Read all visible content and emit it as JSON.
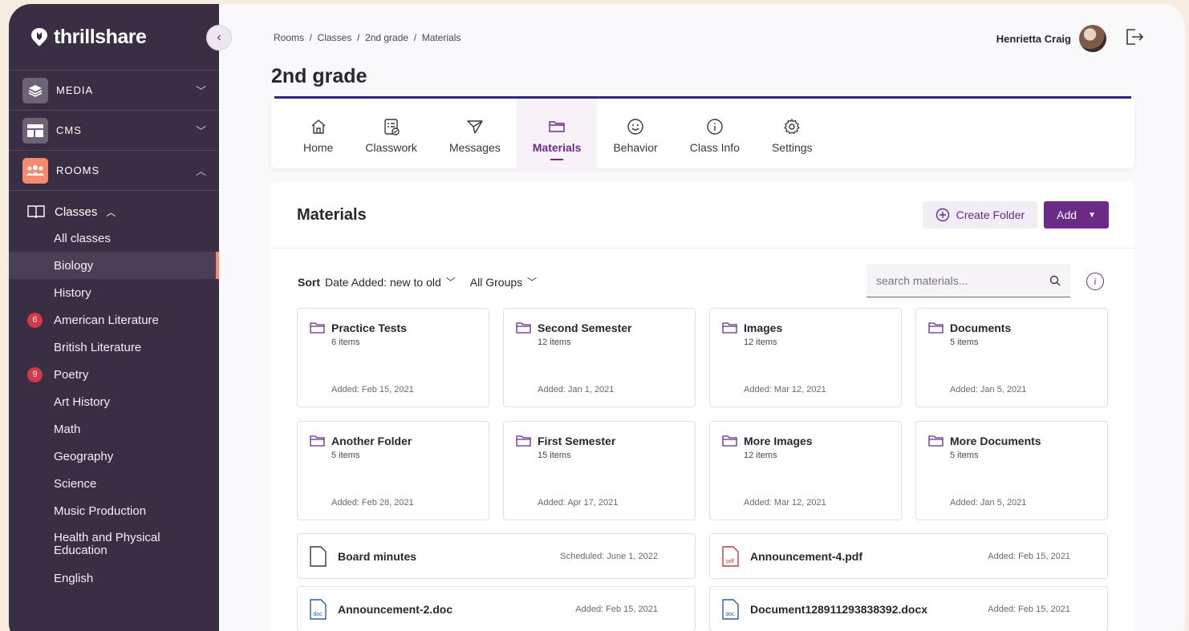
{
  "brand": {
    "name": "thrillshare"
  },
  "sidebar": {
    "sections": [
      {
        "label": "MEDIA",
        "icon": "layers-icon",
        "expanded": false
      },
      {
        "label": "CMS",
        "icon": "layout-icon",
        "expanded": false
      },
      {
        "label": "ROOMS",
        "icon": "people-icon",
        "expanded": true
      }
    ],
    "classes_label": "Classes",
    "items": [
      {
        "label": "All classes"
      },
      {
        "label": "Biology",
        "active": true
      },
      {
        "label": "History"
      },
      {
        "label": "American Literature",
        "badge": "6"
      },
      {
        "label": "British Literature"
      },
      {
        "label": "Poetry",
        "badge": "9"
      },
      {
        "label": "Art History"
      },
      {
        "label": "Math"
      },
      {
        "label": "Geography"
      },
      {
        "label": "Science"
      },
      {
        "label": "Music Production"
      },
      {
        "label": "Health and Physical Education"
      },
      {
        "label": "English"
      }
    ]
  },
  "header": {
    "breadcrumb": "Rooms  /  Classes  /  2nd grade  /  Materials",
    "user_name": "Henrietta Craig",
    "page_title": "2nd grade"
  },
  "tabs": [
    {
      "label": "Home",
      "icon": "home-icon"
    },
    {
      "label": "Classwork",
      "icon": "classwork-icon"
    },
    {
      "label": "Messages",
      "icon": "send-icon"
    },
    {
      "label": "Materials",
      "icon": "folder-icon",
      "active": true
    },
    {
      "label": "Behavior",
      "icon": "smile-icon"
    },
    {
      "label": "Class Info",
      "icon": "info-icon"
    },
    {
      "label": "Settings",
      "icon": "gear-icon"
    }
  ],
  "materials": {
    "title": "Materials",
    "create_folder_label": "Create Folder",
    "add_label": "Add",
    "sort_label": "Sort",
    "sort_value": "Date Added: new to old",
    "group_value": "All Groups",
    "search_placeholder": "search materials...",
    "folders": [
      {
        "name": "Practice Tests",
        "count": "6 items",
        "added": "Added: Feb 15, 2021"
      },
      {
        "name": "Second Semester",
        "count": "12 items",
        "added": "Added: Jan 1, 2021"
      },
      {
        "name": "Images",
        "count": "12 items",
        "added": "Added: Mar 12, 2021"
      },
      {
        "name": "Documents",
        "count": "5 items",
        "added": "Added: Jan 5, 2021"
      },
      {
        "name": "Another Folder",
        "count": "5 items",
        "added": "Added: Feb 28, 2021"
      },
      {
        "name": "First Semester",
        "count": "15 items",
        "added": "Added: Apr 17, 2021"
      },
      {
        "name": "More Images",
        "count": "12 items",
        "added": "Added: Mar 12, 2021"
      },
      {
        "name": "More Documents",
        "count": "5 items",
        "added": "Added: Jan 5, 2021"
      }
    ],
    "files": [
      {
        "name": "Board minutes",
        "date": "Scheduled: June 1, 2022",
        "type": "blank",
        "type_label": ""
      },
      {
        "name": "Announcement-4.pdf",
        "date": "Added: Feb 15, 2021",
        "type": "pdf",
        "type_label": "pdf"
      },
      {
        "name": "Announcement-2.doc",
        "date": "Added: Feb 15, 2021",
        "type": "doc",
        "type_label": "doc"
      },
      {
        "name": "Document128911293838392.docx",
        "date": "Added: Feb 15, 2021",
        "type": "doc",
        "type_label": "doc"
      }
    ]
  },
  "colors": {
    "sidebar": "#3a2e45",
    "accent": "#6a2a86",
    "rooms_icon": "#f58a6f",
    "badge": "#d33a45"
  }
}
